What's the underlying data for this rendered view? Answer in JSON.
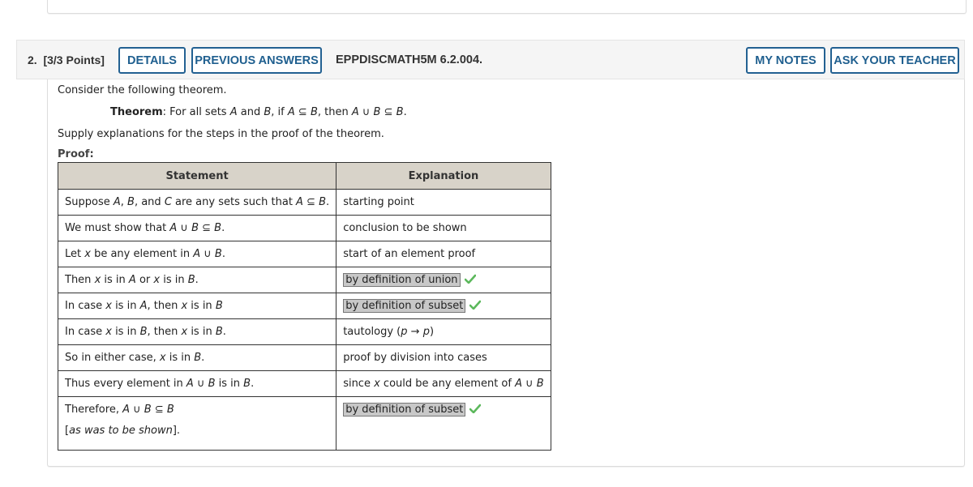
{
  "question": {
    "number": "2.",
    "points": "[3/3 Points]",
    "buttons": {
      "details": "DETAILS",
      "previous_answers": "PREVIOUS ANSWERS",
      "my_notes": "MY NOTES",
      "ask_teacher": "ASK YOUR TEACHER"
    },
    "code": "EPPDISCMATH5M 6.2.004.",
    "accent_color": "#236192"
  },
  "body": {
    "intro": "Consider the following theorem.",
    "theorem_label": "Theorem",
    "theorem_text": ": For all sets A and B, if A ⊆ B, then A ∪ B ⊆ B.",
    "instructions": "Supply explanations for the steps in the proof of the theorem.",
    "proof_label": "Proof:"
  },
  "table": {
    "headers": [
      "Statement",
      "Explanation"
    ],
    "rows": [
      {
        "statement": "Suppose A, B, and C are any sets such that A ⊆ B.",
        "explanation": "starting point",
        "answer": false
      },
      {
        "statement": "We must show that A ∪ B ⊆ B.",
        "explanation": "conclusion to be shown",
        "answer": false
      },
      {
        "statement": "Let x be any element in A ∪ B.",
        "explanation": "start of an element proof",
        "answer": false
      },
      {
        "statement": "Then x is in A or x is in B.",
        "explanation": "by definition of union",
        "answer": true,
        "correct": true
      },
      {
        "statement": "In case x is in A, then x is in B",
        "explanation": "by definition of subset",
        "answer": true,
        "correct": true
      },
      {
        "statement": "In case x is in B, then x is in B.",
        "explanation": "tautology (p → p)",
        "answer": false
      },
      {
        "statement": "So in either case, x is in B.",
        "explanation": "proof by division into cases",
        "answer": false
      },
      {
        "statement": "Thus every element in A ∪ B is in B.",
        "explanation": "since x could be any element of A ∪ B",
        "answer": false
      },
      {
        "statement": "Therefore, A ∪ B ⊆ B",
        "statement_2": "[as was to be shown].",
        "explanation": "by definition of subset",
        "answer": true,
        "correct": true
      }
    ]
  },
  "icons": {
    "correct": "checkmark-icon"
  },
  "colors": {
    "check": "#5cb85c",
    "header_bg": "#d8d3c9",
    "answer_bg": "#c8c8c8"
  }
}
